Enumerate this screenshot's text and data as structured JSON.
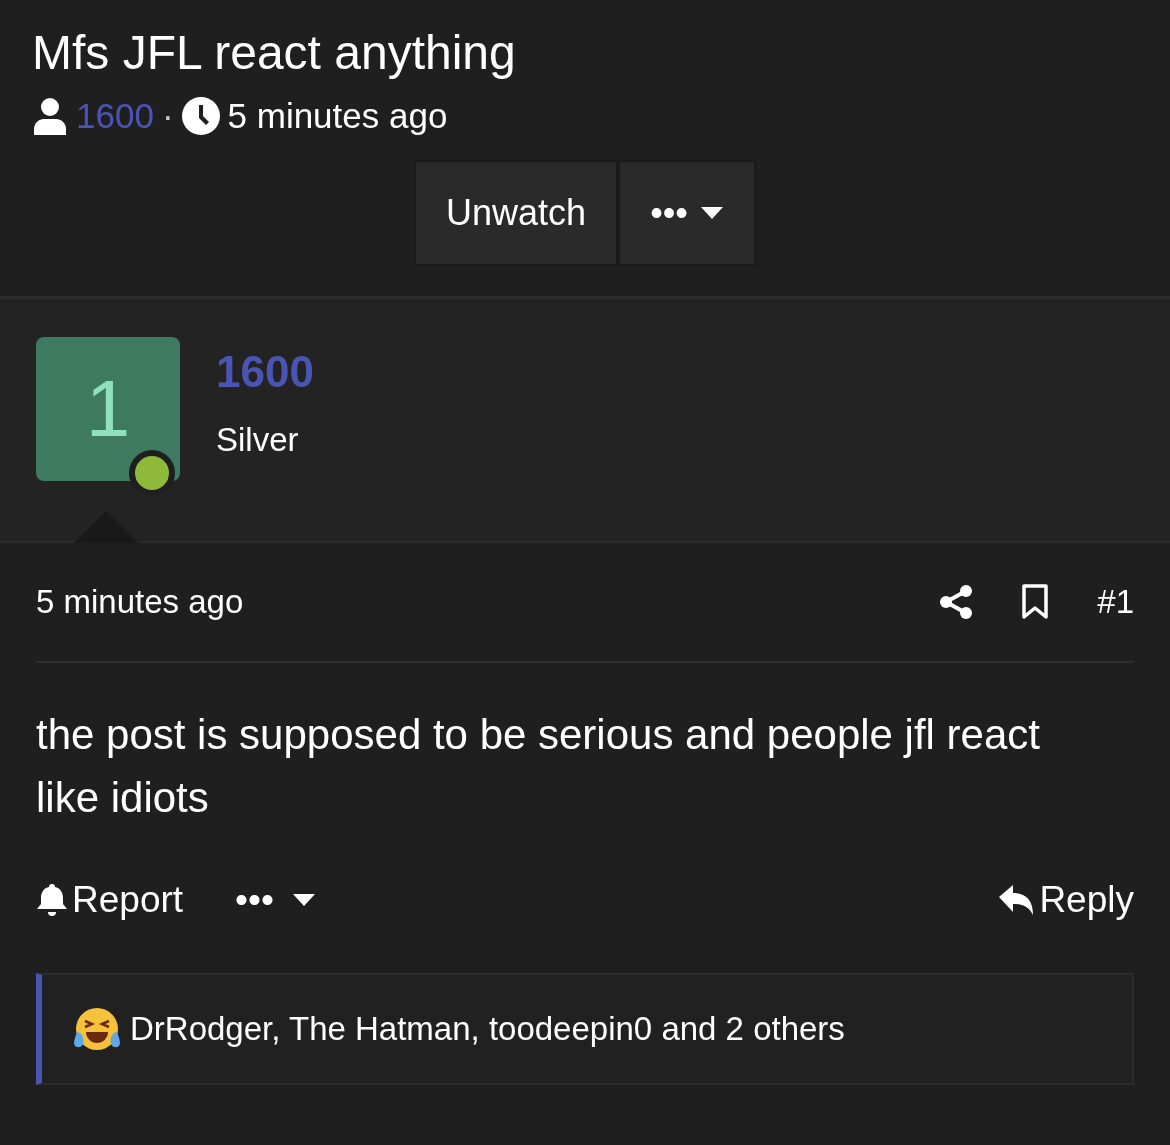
{
  "thread": {
    "title": "Mfs JFL react anything",
    "author": "1600",
    "separator": "·",
    "time": "5 minutes ago"
  },
  "thread_buttons": [
    {
      "kind": "text",
      "label": "Unwatch"
    },
    {
      "kind": "more",
      "label": "•••"
    }
  ],
  "post": {
    "avatar_letter": "1",
    "author": "1600",
    "rank": "Silver",
    "time": "5 minutes ago",
    "number": "#1",
    "body": "the post is supposed to be serious and people jfl react like idiots",
    "actions": [
      {
        "kind": "report",
        "label": "Report"
      },
      {
        "kind": "more",
        "label": "•••"
      },
      {
        "kind": "reply",
        "label": "Reply"
      }
    ],
    "reactions": "DrRodger, The Hatman, toodeepin0 and 2 others"
  }
}
